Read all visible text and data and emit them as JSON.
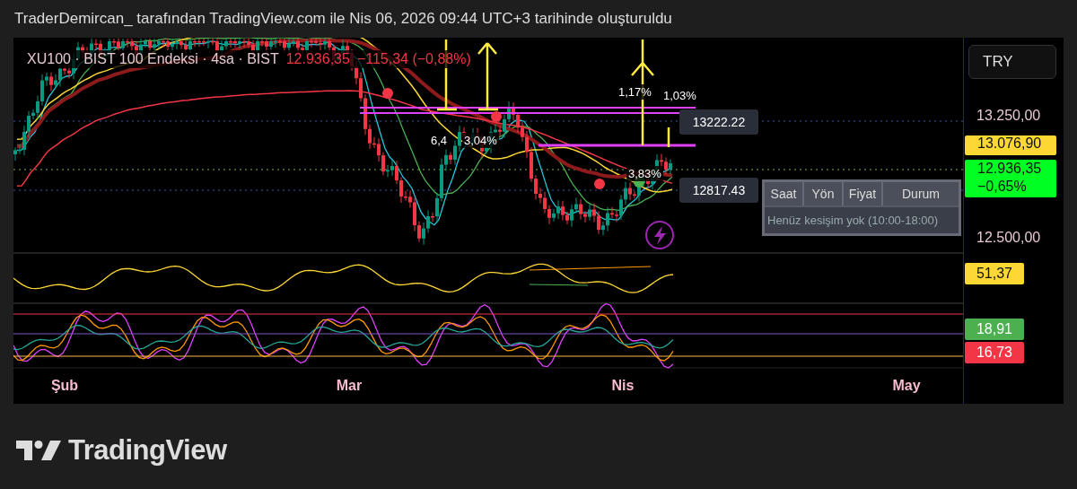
{
  "header": {
    "text": "TraderDemircan_ tarafından TradingView.com ile Nis 06, 2026 09:44 UTC+3 tarihinde oluşturuldu"
  },
  "legend": {
    "symbol": "XU100 · BIST 100 Endeksi · 4sa · BIST",
    "price": "12.936,35",
    "change": "−115,34 (−0,88%)"
  },
  "currency_button": "TRY",
  "price_axis": {
    "ticks": [
      "13.250,00",
      "12.500,00"
    ],
    "badges": [
      {
        "text": "13.076,90",
        "color": "#fdd835"
      },
      {
        "text": "12.936,35",
        "sub": "−0,65%",
        "color": "#00ff22"
      }
    ]
  },
  "annotations": [
    "1,17%",
    "1,03%",
    "6,4",
    "3,04%",
    "3,83%"
  ],
  "callouts": [
    "13222.22",
    "12817.43"
  ],
  "crossings_table": {
    "columns": [
      "Saat",
      "Yön",
      "Fiyat",
      "Durum"
    ],
    "empty_message": "Henüz kesişim yok (10:00-18:00)"
  },
  "rsi_pane": {
    "badge": {
      "text": "51,37",
      "color": "#fdd835"
    }
  },
  "oscillator_pane": {
    "badges": [
      {
        "text": "18,91",
        "color": "#4caf50"
      },
      {
        "text": "16,73",
        "color": "#f23645"
      }
    ]
  },
  "time_axis": [
    "Şub",
    "Mar",
    "Nis",
    "May"
  ],
  "footer": {
    "brand": "TradingView"
  }
}
